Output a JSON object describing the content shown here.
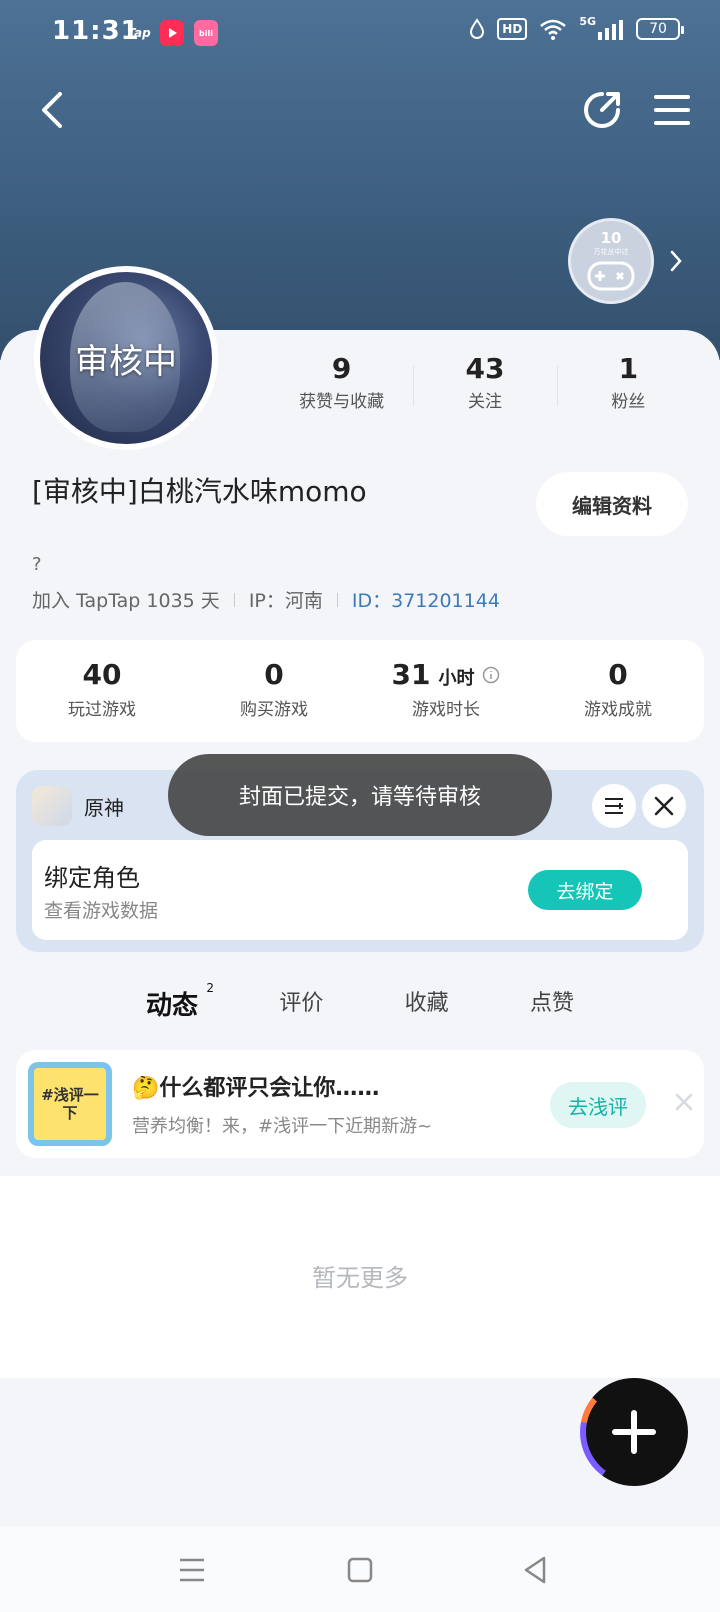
{
  "status_bar": {
    "time": "11:31",
    "apps": [
      "Tap",
      "youtube-icon",
      "bilibili-icon"
    ],
    "hd": "HD",
    "network": "5G",
    "battery": "70"
  },
  "header": {
    "badge_level": "10",
    "badge_caption": "万花丛中过"
  },
  "profile": {
    "avatar_overlay": "审核中",
    "username": "[审核中]白桃汽水味momo",
    "edit_label": "编辑资料",
    "bio": "?",
    "joined": "加入 TapTap 1035 天",
    "ip": "IP：河南",
    "id": "ID：371201144",
    "stats": [
      {
        "num": "9",
        "label": "获赞与收藏"
      },
      {
        "num": "43",
        "label": "关注"
      },
      {
        "num": "1",
        "label": "粉丝"
      }
    ]
  },
  "game_stats": [
    {
      "num": "40",
      "unit": "",
      "label": "玩过游戏"
    },
    {
      "num": "0",
      "unit": "",
      "label": "购买游戏"
    },
    {
      "num": "31",
      "unit": "小时",
      "label": "游戏时长"
    },
    {
      "num": "0",
      "unit": "",
      "label": "游戏成就"
    }
  ],
  "game_card": {
    "name": "原神",
    "bind_title": "绑定角色",
    "bind_subtitle": "查看游戏数据",
    "bind_button": "去绑定"
  },
  "toast": "封面已提交，请等待审核",
  "tabs": [
    {
      "label": "动态",
      "count": "2"
    },
    {
      "label": "评价"
    },
    {
      "label": "收藏"
    },
    {
      "label": "点赞"
    }
  ],
  "promo": {
    "image_text": "#浅评一下",
    "title": "🤔什么都评只会让你……",
    "subtitle": "营养均衡！来，#浅评一下近期新游~",
    "button": "去浅评"
  },
  "empty_text": "暂无更多",
  "colors": {
    "accent": "#15c5b8",
    "header": "#3e5f80",
    "id_link": "#3d7bb8"
  }
}
